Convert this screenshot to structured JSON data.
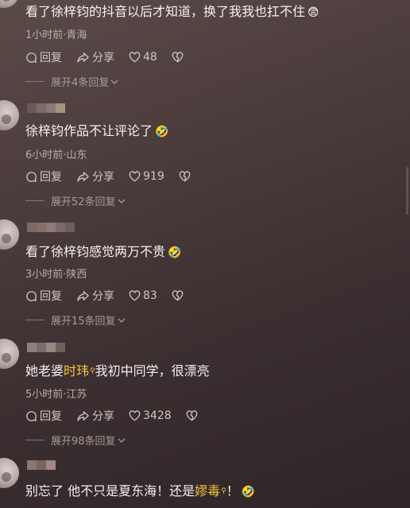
{
  "comments": [
    {
      "text": "看了徐梓钧的抖音以后才知道，换了我我也扛不住",
      "emoji": "😨",
      "meta": "1小时前·青海",
      "reply": "回复",
      "share": "分享",
      "likes": "48",
      "expand": "展开4条回复"
    },
    {
      "text": "徐梓钧作品不让评论了",
      "emoji": "🤣",
      "meta": "6小时前·山东",
      "reply": "回复",
      "share": "分享",
      "likes": "919",
      "expand": "展开52条回复"
    },
    {
      "text": "看了徐梓钧感觉两万不贵",
      "emoji": "🤣",
      "meta": "3小时前·陕西",
      "reply": "回复",
      "share": "分享",
      "likes": "83",
      "expand": "展开15条回复"
    },
    {
      "text_pre": "她老婆",
      "link": "时玮",
      "text_post": "我初中同学，很漂亮",
      "meta": "5小时前·江苏",
      "reply": "回复",
      "share": "分享",
      "likes": "3428",
      "expand": "展开98条回复"
    },
    {
      "text_pre": "别忘了 他不只是夏东海！还是",
      "link": "嫪毒",
      "text_post": "！",
      "emoji": "🤣"
    }
  ],
  "icons": {
    "reply": "comment-bubble-icon",
    "share": "share-arrow-icon",
    "like": "heart-icon",
    "dislike": "broken-heart-icon",
    "expand": "chevron-down-icon"
  },
  "colors": {
    "mention": "#f5c542",
    "text": "#f4f1f0",
    "meta": "#b8aeac"
  }
}
